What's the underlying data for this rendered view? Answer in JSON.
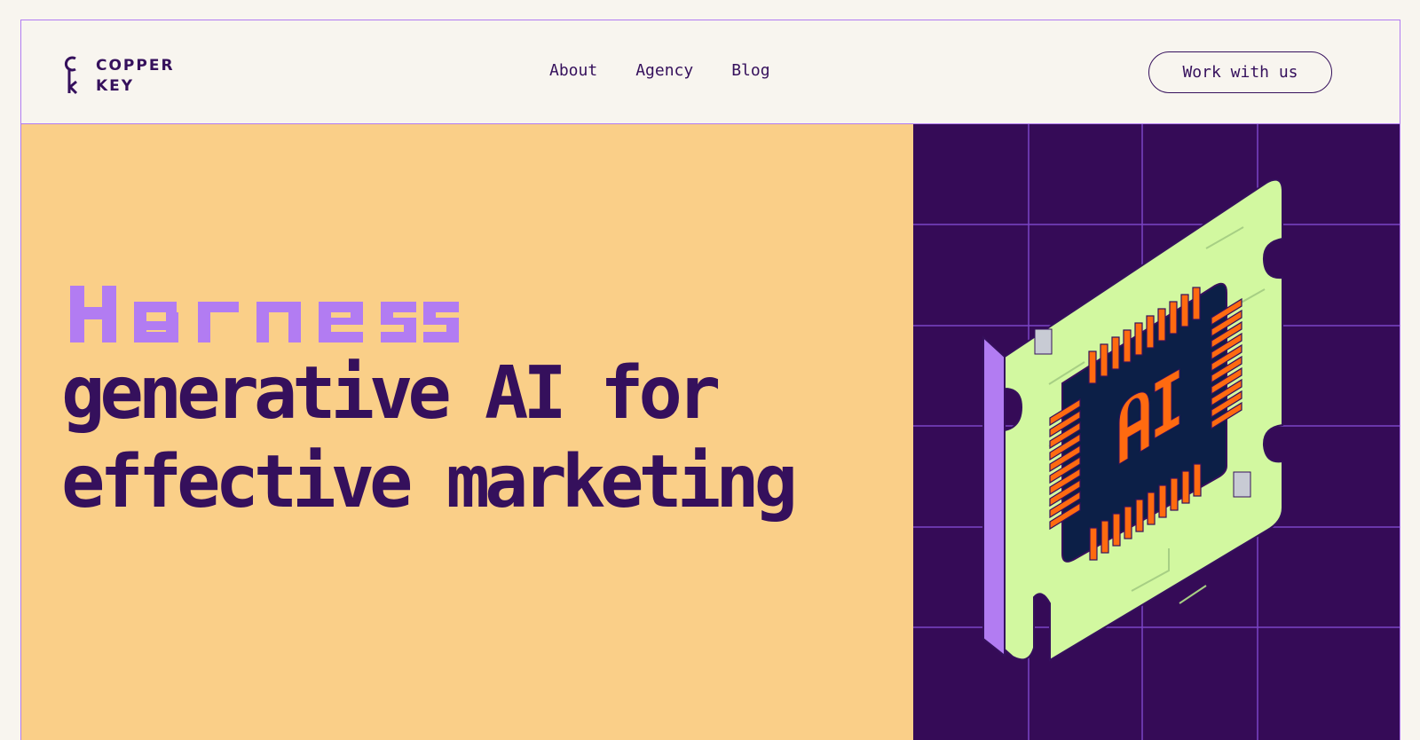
{
  "brand": {
    "logo_line1": "COPPER",
    "logo_line2": "KEY",
    "logo_icon": "key-icon",
    "ink_color": "#35105c",
    "accent_color": "#b27cf2"
  },
  "nav": {
    "items": [
      {
        "label": "About"
      },
      {
        "label": "Agency"
      },
      {
        "label": "Blog"
      }
    ],
    "cta_label": "Work with us"
  },
  "hero": {
    "highlight_word": "Harness",
    "title_line1": "generative AI for",
    "title_line2": "effective marketing",
    "background_color": "#facf88",
    "highlight_color": "#b27cf2",
    "illustration": {
      "name": "ai-chip-illustration",
      "chip_label": "AI",
      "board_color": "#d2f8a0",
      "chip_color": "#0c1f47",
      "pin_color": "#ff6a10",
      "background_color": "#350b57"
    }
  }
}
